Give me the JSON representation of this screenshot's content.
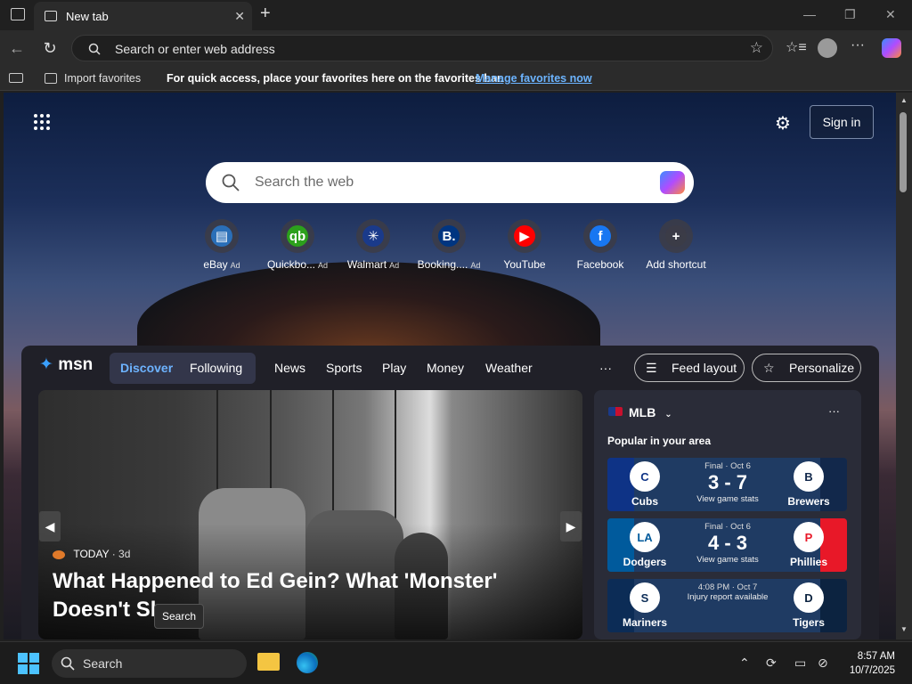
{
  "browser": {
    "tab_title": "New tab",
    "address_placeholder": "Search or enter web address"
  },
  "favorites_bar": {
    "import_label": "Import favorites",
    "message": "For quick access, place your favorites here on the favorites bar.",
    "manage_link": "Manage favorites now"
  },
  "newtab": {
    "signin_label": "Sign in",
    "search_placeholder": "Search the web",
    "shortcuts": [
      {
        "label": "eBay",
        "ad": "Ad",
        "glyph": "▤"
      },
      {
        "label": "Quickbo...",
        "ad": "Ad",
        "glyph": "qb"
      },
      {
        "label": "Walmart",
        "ad": "Ad",
        "glyph": "✳"
      },
      {
        "label": "Booking....",
        "ad": "Ad",
        "glyph": "B."
      },
      {
        "label": "YouTube",
        "ad": "",
        "glyph": "▶"
      },
      {
        "label": "Facebook",
        "ad": "",
        "glyph": "f"
      },
      {
        "label": "Add shortcut",
        "ad": "",
        "glyph": "+"
      }
    ]
  },
  "feed": {
    "logo_text": "msn",
    "tabs": {
      "discover": "Discover",
      "following": "Following"
    },
    "nav": [
      "News",
      "Sports",
      "Play",
      "Money",
      "Weather"
    ],
    "more": "···",
    "feed_layout_label": "Feed layout",
    "personalize_label": "Personalize",
    "hero": {
      "source": "TODAY",
      "age": "· 3d",
      "headline": "What Happened to Ed Gein? What 'Monster' Doesn't Show",
      "tooltip": "Search"
    }
  },
  "mlb": {
    "title": "MLB",
    "more": "···",
    "subtitle": "Popular in your area",
    "games": [
      {
        "home": "Cubs",
        "away": "Brewers",
        "status": "Final · Oct 6",
        "score": "3 - 7",
        "link": "View game stats",
        "home_logo": "C",
        "away_logo": "B",
        "home_color": "#0e3386",
        "away_color": "#12284b"
      },
      {
        "home": "Dodgers",
        "away": "Phillies",
        "status": "Final · Oct 6",
        "score": "4 - 3",
        "link": "View game stats",
        "home_logo": "LA",
        "away_logo": "P",
        "home_color": "#005a9c",
        "away_color": "#e81828"
      },
      {
        "home": "Mariners",
        "away": "Tigers",
        "status": "4:08 PM · Oct 7",
        "score": "",
        "link": "Injury report available",
        "home_logo": "S",
        "away_logo": "D",
        "home_color": "#0c2c56",
        "away_color": "#0c2340"
      }
    ]
  },
  "taskbar": {
    "search_placeholder": "Search",
    "time": "8:57 AM",
    "date": "10/7/2025"
  }
}
